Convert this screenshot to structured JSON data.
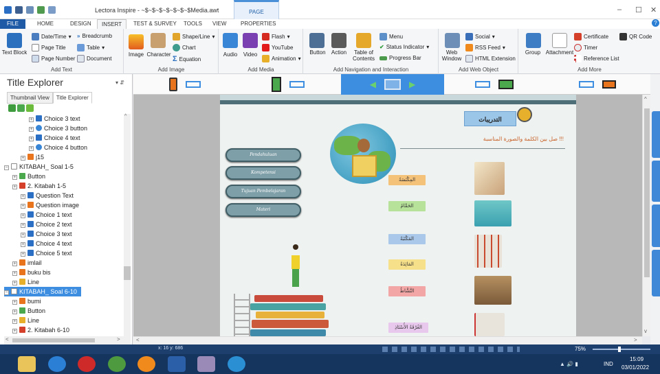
{
  "app": {
    "title": "Lectora Inspire - ~$~$~$~$~$~$~$Media.awt",
    "context_tab": "PAGE"
  },
  "tabs": [
    "FILE",
    "HOME",
    "DESIGN",
    "INSERT",
    "TEST & SURVEY",
    "TOOLS",
    "VIEW",
    "PROPERTIES"
  ],
  "ribbon": {
    "text_group": {
      "label": "Add Text",
      "text_block": "Text Block",
      "date_time": "Date/Time",
      "breadcrumb": "Breadcrumb",
      "page_title": "Page Title",
      "table": "Table",
      "page_number": "Page Number",
      "document": "Document"
    },
    "image_group": {
      "label": "Add Image",
      "image": "Image",
      "character": "Character",
      "shape_line": "Shape/Line",
      "chart": "Chart",
      "equation": "Equation"
    },
    "media_group": {
      "label": "Add Media",
      "audio": "Audio",
      "video": "Video",
      "flash": "Flash",
      "youtube": "YouTube",
      "animation": "Animation"
    },
    "nav_group": {
      "label": "Add Navigation and Interaction",
      "button": "Button",
      "action": "Action",
      "toc": "Table of Contents",
      "menu": "Menu",
      "status_indicator": "Status Indicator",
      "progress_bar": "Progress Bar"
    },
    "web_group": {
      "label": "Add Web Object",
      "web_window": "Web Window",
      "social": "Social",
      "rss": "RSS Feed",
      "html_extension": "HTML Extension"
    },
    "more_group": {
      "label": "Add More",
      "group": "Group",
      "attachment": "Attachment",
      "certificate": "Certificate",
      "qr_code": "QR Code",
      "timer": "Timer",
      "reference_list": "Reference List"
    }
  },
  "panel": {
    "title": "Title Explorer",
    "tab_thumbnail": "Thumbnail View",
    "tab_title": "Title Explorer",
    "tree": [
      {
        "label": "Choice 3 text",
        "icon": "text-icon",
        "indent": 3
      },
      {
        "label": "Choice 3 button",
        "icon": "radio-icon",
        "indent": 3
      },
      {
        "label": "Choice 4 text",
        "icon": "text-icon",
        "indent": 3
      },
      {
        "label": "Choice 4 button",
        "icon": "radio-icon",
        "indent": 3
      },
      {
        "label": "j15",
        "icon": "image-icon",
        "indent": 2
      },
      {
        "label": "KITABAH_ Soal 1-5",
        "icon": "page-icon",
        "indent": 0
      },
      {
        "label": "Button",
        "icon": "button-icon",
        "indent": 1
      },
      {
        "label": "2. Kitabah 1-5",
        "icon": "question-icon",
        "indent": 1
      },
      {
        "label": "Question Text",
        "icon": "text-icon",
        "indent": 2
      },
      {
        "label": "Question image",
        "icon": "image-icon",
        "indent": 2
      },
      {
        "label": "Choice 1 text",
        "icon": "text-icon",
        "indent": 2
      },
      {
        "label": "Choice 2 text",
        "icon": "text-icon",
        "indent": 2
      },
      {
        "label": "Choice 3 text",
        "icon": "text-icon",
        "indent": 2
      },
      {
        "label": "Choice 4 text",
        "icon": "text-icon",
        "indent": 2
      },
      {
        "label": "Choice 5 text",
        "icon": "text-icon",
        "indent": 2
      },
      {
        "label": "imlail",
        "icon": "image-icon",
        "indent": 1
      },
      {
        "label": "buku bis",
        "icon": "image-icon",
        "indent": 1
      },
      {
        "label": "Line",
        "icon": "line-icon",
        "indent": 1
      },
      {
        "label": "KITABAH_ Soal 6-10",
        "icon": "page-icon",
        "indent": 0,
        "selected": true
      },
      {
        "label": "bumi",
        "icon": "image-icon",
        "indent": 1
      },
      {
        "label": "Button",
        "icon": "button-icon",
        "indent": 1
      },
      {
        "label": "Line",
        "icon": "line-icon",
        "indent": 1
      },
      {
        "label": "2. Kitabah 6-10",
        "icon": "question-icon",
        "indent": 1
      }
    ]
  },
  "slide": {
    "header_title": "التدريبات",
    "instruction": "صل بين الكلمة والصورة المناسبة !!!",
    "menu_buttons": [
      "Pendahuluan",
      "Kompetensi",
      "Tujuan Pembelajaran",
      "Materi"
    ],
    "words": [
      "المِكْنَسَةُ",
      "الحَمَّامُ",
      "المَكْتَبَةُ",
      "المَائِدَةُ",
      "النَّشَّاطُ",
      "الغُرْفَةُ الأُسْتَاذِ"
    ]
  },
  "status": {
    "coords": "x: 16  y: 686",
    "zoom": "75%"
  },
  "taskbar": {
    "lang": "IND",
    "time": "15:09",
    "date": "03/01/2022"
  }
}
